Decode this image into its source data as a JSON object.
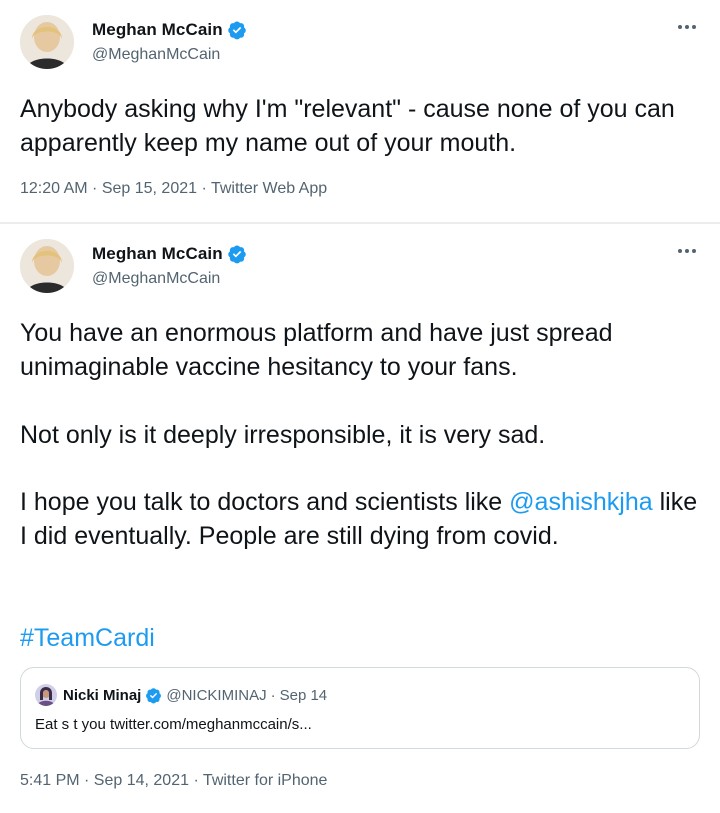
{
  "tweets": [
    {
      "author": {
        "name": "Meghan McCain",
        "handle": "@MeghanMcCain",
        "verified": true
      },
      "text": "Anybody asking why I'm \"relevant\" - cause none of you can apparently keep my name out of your mouth.",
      "meta": "12:20 AM · Sep 15, 2021 · Twitter Web App"
    },
    {
      "author": {
        "name": "Meghan McCain",
        "handle": "@MeghanMcCain",
        "verified": true
      },
      "paragraphs": {
        "p1": "You have an enormous platform and have just spread unimaginable vaccine hesitancy to your fans.",
        "p2": "Not only is it deeply irresponsible, it is very sad.",
        "p3_before": "I hope you talk to doctors and scientists like ",
        "p3_mention": "@ashishkjha",
        "p3_after": " like I did eventually. People are still dying from covid.",
        "hashtag": "#TeamCardi"
      },
      "quoted": {
        "name": "Nicki Minaj",
        "handle": "@NICKIMINAJ",
        "separator": "·",
        "date": "Sep 14",
        "text": "Eat s  t you twitter.com/meghanmccain/s..."
      },
      "meta": "5:41 PM · Sep 14, 2021 · Twitter for iPhone"
    }
  ],
  "colors": {
    "link": "#1d9bf0",
    "verified": "#1d9bf0",
    "secondary_text": "#536471"
  },
  "icons": {
    "verified": "verified-badge-icon",
    "more": "more-options-icon"
  }
}
